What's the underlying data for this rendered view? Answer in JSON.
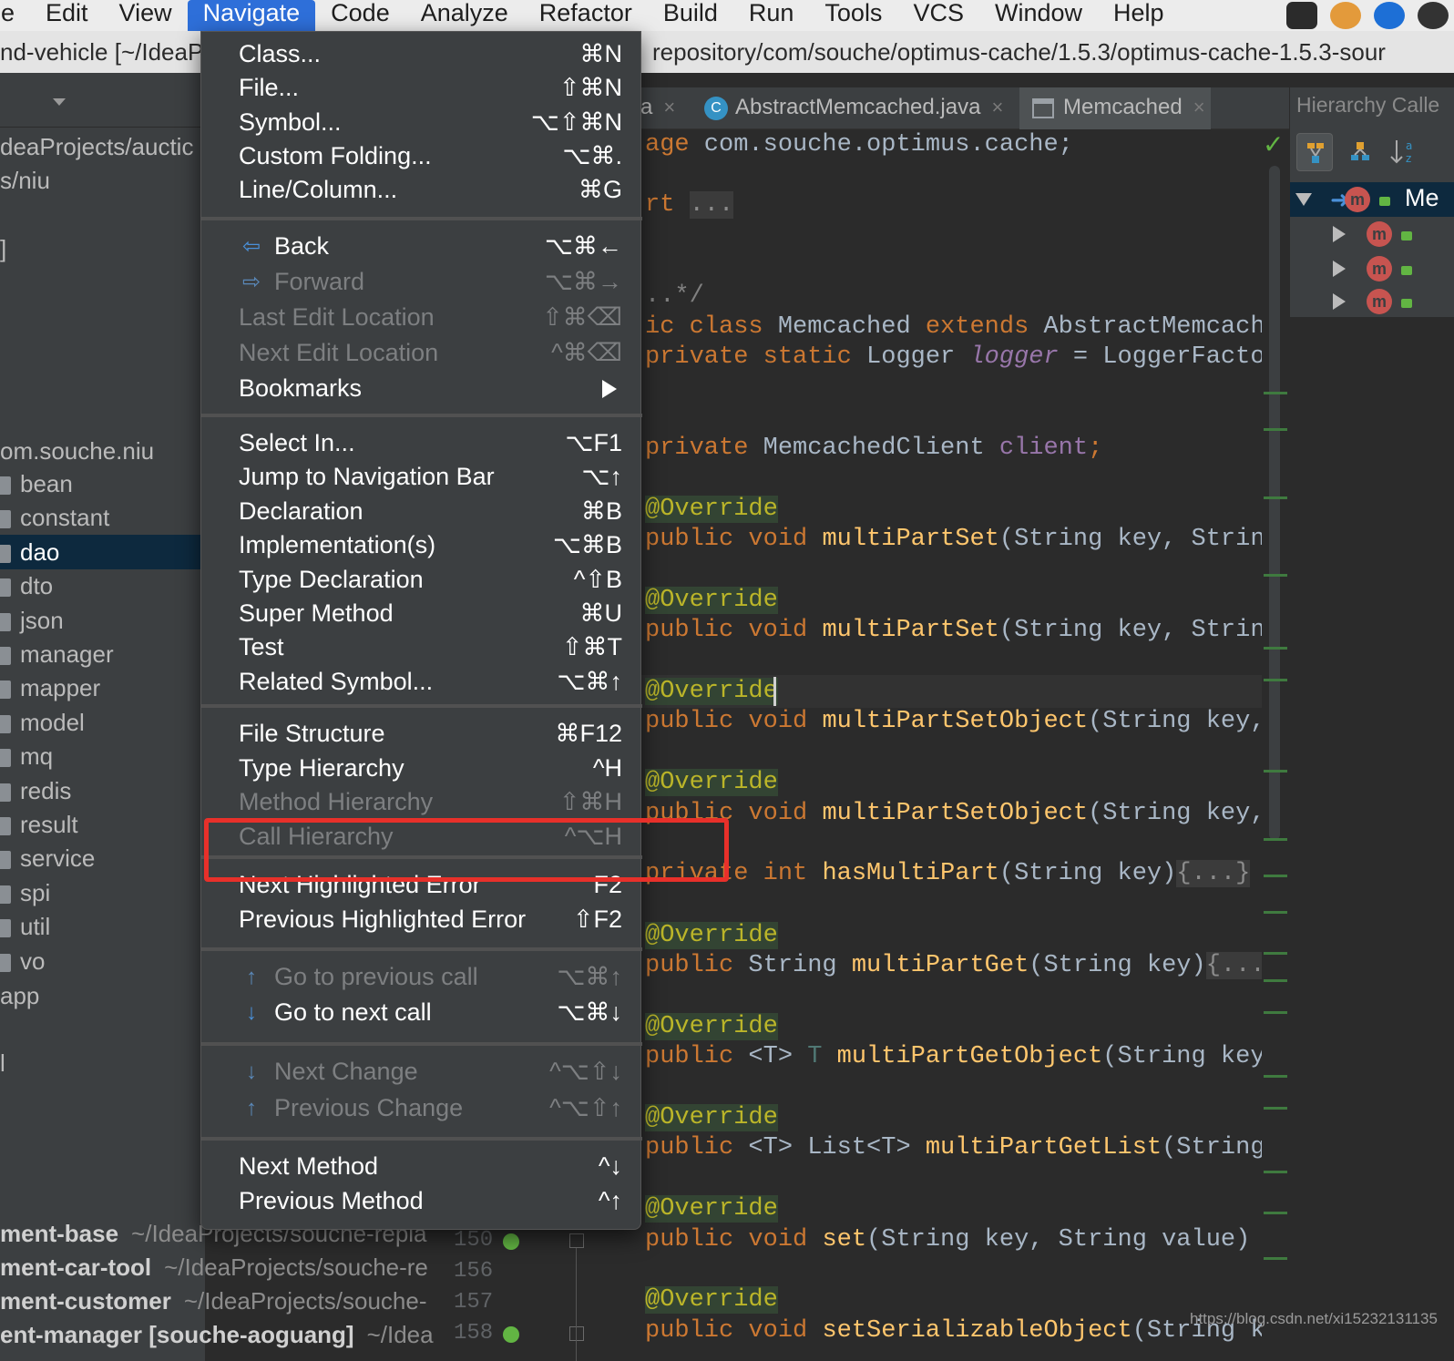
{
  "menubar": {
    "items": [
      "le",
      "Edit",
      "View",
      "Navigate",
      "Code",
      "Analyze",
      "Refactor",
      "Build",
      "Run",
      "Tools",
      "VCS",
      "Window",
      "Help"
    ],
    "active": "Navigate",
    "tray_icons": [
      "pen-icon",
      "clock-icon",
      "teamviewer-icon",
      "extra-icon"
    ]
  },
  "pathbar": {
    "left": "nd-vehicle [~/IdeaP",
    "right": "repository/com/souche/optimus-cache/1.5.3/optimus-cache-1.5.3-sour"
  },
  "project_tree": {
    "lines": [
      "deaProjects/auctic",
      "s/niu",
      "]",
      "om.souche.niu"
    ],
    "folders": [
      "bean",
      "constant",
      "dao",
      "dto",
      "json",
      "manager",
      "mapper",
      "model",
      "mq",
      "redis",
      "result",
      "service",
      "spi",
      "util",
      "vo"
    ],
    "selected": "dao",
    "after": [
      "app",
      "l"
    ],
    "projects": [
      {
        "name": "ment-base",
        "path": "~/IdeaProjects/souche-repla"
      },
      {
        "name": "ment-car-tool",
        "path": "~/IdeaProjects/souche-re"
      },
      {
        "name": "ment-customer",
        "path": "~/IdeaProjects/souche-"
      },
      {
        "name": "ent-manager [souche-aoguang]",
        "path": "~/Idea"
      }
    ]
  },
  "gutter": {
    "lines": [
      "150",
      "156",
      "157",
      "158"
    ]
  },
  "tabs": [
    {
      "label": "a",
      "close": "×"
    },
    {
      "label": "AbstractMemcached.java",
      "close": "×",
      "icon_text": "C"
    },
    {
      "label": "Memcached",
      "close": "×"
    }
  ],
  "code": {
    "package_kw": "age",
    "package_name": " com.souche.optimus.cache;",
    "import_kw": "rt",
    "import_fold": "...",
    "doc_fold": "..*/",
    "class_line": {
      "kw1": "ic class",
      "name": " Memcached ",
      "kw2": "extends",
      "parent": " AbstractMemcached"
    },
    "logger_line": {
      "kw": "private static",
      "type": " Logger ",
      "field": "logger",
      "rest": " = LoggerFactory."
    },
    "client_line": {
      "kw": "private",
      "type": " MemcachedClient ",
      "field": "client",
      "semi": ";"
    },
    "annotation": "@Override",
    "methods": [
      {
        "kw": "public void",
        "name": "multiPartSet",
        "args": "(String key, String v"
      },
      {
        "kw": "public void",
        "name": "multiPartSet",
        "args": "(String key, String v"
      },
      {
        "kw": "public void",
        "name": "multiPartSetObject",
        "args": "(String key, Ob"
      },
      {
        "kw": "public void",
        "name": "multiPartSetObject",
        "args": "(String key, Ob"
      },
      {
        "kw": "private int",
        "name": "hasMultiPart",
        "args": "(String key)",
        "fold": "{...}"
      },
      {
        "kw": "public",
        "type": " String ",
        "name": "multiPartGet",
        "args": "(String key)",
        "fold": "{...}"
      },
      {
        "kw": "public",
        "type": " <T> ",
        "t": "T ",
        "name": "multiPartGetObject",
        "args": "(String key, C"
      },
      {
        "kw": "public",
        "type": " <T> List<T> ",
        "name": "multiPartGetList",
        "args": "(String ke"
      },
      {
        "kw": "public void",
        "name": "set",
        "args": "(String key, String value) ",
        "fold": "{.."
      },
      {
        "kw": "public void",
        "name": "setSerializableObject",
        "args": "(String key,"
      }
    ]
  },
  "hierarchy": {
    "title": "Hierarchy Calle",
    "root_label": "Me",
    "children_count": 3,
    "badge": "m"
  },
  "navigate_menu": {
    "groups": [
      [
        {
          "label": "Class...",
          "shortcut": "⌘N",
          "enabled": true
        },
        {
          "label": "File...",
          "shortcut": "⇧⌘N",
          "enabled": true
        },
        {
          "label": "Symbol...",
          "shortcut": "⌥⇧⌘N",
          "enabled": true
        },
        {
          "label": "Custom Folding...",
          "shortcut": "⌥⌘.",
          "enabled": true
        },
        {
          "label": "Line/Column...",
          "shortcut": "⌘G",
          "enabled": true
        }
      ],
      [
        {
          "label": "Back",
          "shortcut": "⌥⌘←",
          "enabled": true,
          "icon": "back-arrow-icon",
          "glyph": "⇦"
        },
        {
          "label": "Forward",
          "shortcut": "⌥⌘→",
          "enabled": false,
          "icon": "forward-arrow-icon",
          "glyph": "⇨"
        },
        {
          "label": "Last Edit Location",
          "shortcut": "⇧⌘⌫",
          "enabled": false
        },
        {
          "label": "Next Edit Location",
          "shortcut": "^⌘⌫",
          "enabled": false
        },
        {
          "label": "Bookmarks",
          "shortcut": "",
          "enabled": true,
          "submenu": true
        }
      ],
      [
        {
          "label": "Select In...",
          "shortcut": "⌥F1",
          "enabled": true
        },
        {
          "label": "Jump to Navigation Bar",
          "shortcut": "⌥↑",
          "enabled": true
        },
        {
          "label": "Declaration",
          "shortcut": "⌘B",
          "enabled": true
        },
        {
          "label": "Implementation(s)",
          "shortcut": "⌥⌘B",
          "enabled": true
        },
        {
          "label": "Type Declaration",
          "shortcut": "^⇧B",
          "enabled": true
        },
        {
          "label": "Super Method",
          "shortcut": "⌘U",
          "enabled": true
        },
        {
          "label": "Test",
          "shortcut": "⇧⌘T",
          "enabled": true
        },
        {
          "label": "Related Symbol...",
          "shortcut": "⌥⌘↑",
          "enabled": true
        }
      ],
      [
        {
          "label": "File Structure",
          "shortcut": "⌘F12",
          "enabled": true
        },
        {
          "label": "Type Hierarchy",
          "shortcut": "^H",
          "enabled": true
        },
        {
          "label": "Method Hierarchy",
          "shortcut": "⇧⌘H",
          "enabled": false
        },
        {
          "label": "Call Hierarchy",
          "shortcut": "^⌥H",
          "enabled": false
        }
      ],
      [
        {
          "label": "Next Highlighted Error",
          "shortcut": "F2",
          "enabled": true
        },
        {
          "label": "Previous Highlighted Error",
          "shortcut": "⇧F2",
          "enabled": true
        }
      ],
      [
        {
          "label": "Go to previous call",
          "shortcut": "⌥⌘↑",
          "enabled": false,
          "icon": "up-arrow-icon",
          "glyph": "↑"
        },
        {
          "label": "Go to next call",
          "shortcut": "⌥⌘↓",
          "enabled": true,
          "icon": "down-arrow-icon",
          "glyph": "↓"
        }
      ],
      [
        {
          "label": "Next Change",
          "shortcut": "^⌥⇧↓",
          "enabled": false,
          "icon": "down-arrow-icon",
          "glyph": "↓"
        },
        {
          "label": "Previous Change",
          "shortcut": "^⌥⇧↑",
          "enabled": false,
          "icon": "up-arrow-icon",
          "glyph": "↑"
        }
      ],
      [
        {
          "label": "Next Method",
          "shortcut": "^↓",
          "enabled": true
        },
        {
          "label": "Previous Method",
          "shortcut": "^↑",
          "enabled": true
        }
      ]
    ]
  },
  "watermark": "https://blog.csdn.net/xi15232131135",
  "colors": {
    "menu_highlight": "#2e6fd9",
    "annotation_box": "#e8302a",
    "keyword": "#cc7832",
    "method": "#ffc66d",
    "field": "#9876aa"
  }
}
